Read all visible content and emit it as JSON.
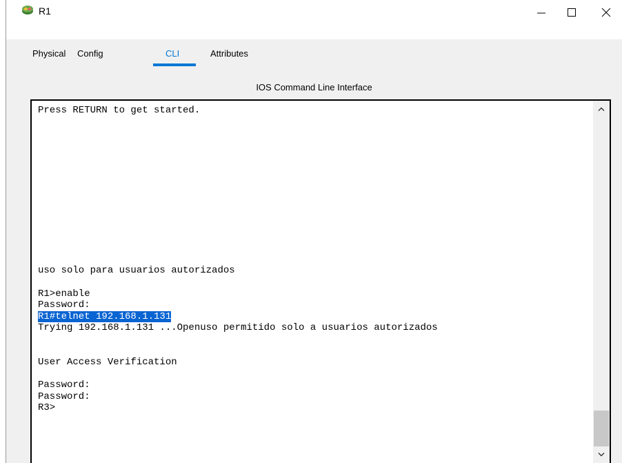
{
  "window": {
    "title": "R1",
    "icon": "router-icon"
  },
  "tabs": [
    {
      "label": "Physical",
      "active": false
    },
    {
      "label": "Config",
      "active": false
    },
    {
      "label": "CLI",
      "active": true
    },
    {
      "label": "Attributes",
      "active": false
    }
  ],
  "cli": {
    "header": "IOS Command Line Interface",
    "lines": [
      "Press RETURN to get started.",
      "",
      "",
      "",
      "",
      "",
      "",
      "",
      "",
      "",
      "",
      "",
      "",
      "",
      "uso solo para usuarios autorizados",
      "",
      "R1>enable",
      "Password:",
      "R1#telnet 192.168.1.131",
      "Trying 192.168.1.131 ...Openuso permitido solo a usuarios autorizados",
      "",
      "",
      "User Access Verification",
      "",
      "Password:",
      "Password:",
      "R3>"
    ],
    "selected_line": "R1#telnet 192.168.1.131"
  },
  "colors": {
    "accent": "#0078d7",
    "selection": "#0a64d2",
    "panel": "#f0f0f0"
  }
}
